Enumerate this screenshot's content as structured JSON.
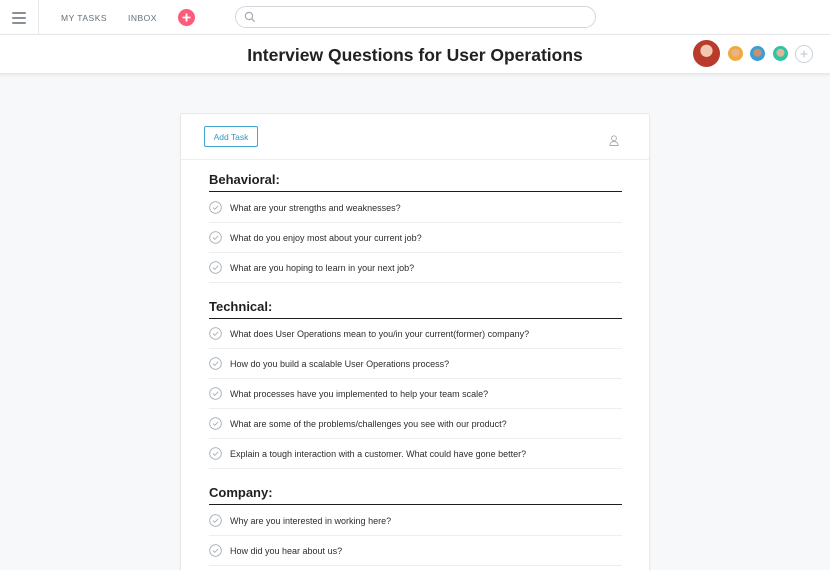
{
  "topbar": {
    "nav": {
      "my_tasks": "MY TASKS",
      "inbox": "INBOX"
    },
    "search": {
      "placeholder": ""
    },
    "quick_add_color": "#fc5c7a"
  },
  "header": {
    "title": "Interview Questions for User Operations"
  },
  "toolbar": {
    "add_task_label": "Add Task"
  },
  "sections": [
    {
      "title": "Behavioral:",
      "tasks": [
        "What are your strengths and weaknesses?",
        "What do you enjoy most about your current job?",
        "What are you hoping to learn in your next job?"
      ]
    },
    {
      "title": "Technical:",
      "tasks": [
        "What does User Operations mean to you/in your current(former) company?",
        "How do you build a scalable User Operations process?",
        "What processes have you implemented to help your team scale?",
        "What are some of the problems/challenges you see with our product?",
        "Explain a tough interaction with a customer. What could have gone better?"
      ]
    },
    {
      "title": "Company:",
      "tasks": [
        "Why are you interested in working here?",
        "How did you hear about us?"
      ]
    }
  ],
  "colors": {
    "accent": "#3fa6cf",
    "background": "#f6f8f9"
  }
}
